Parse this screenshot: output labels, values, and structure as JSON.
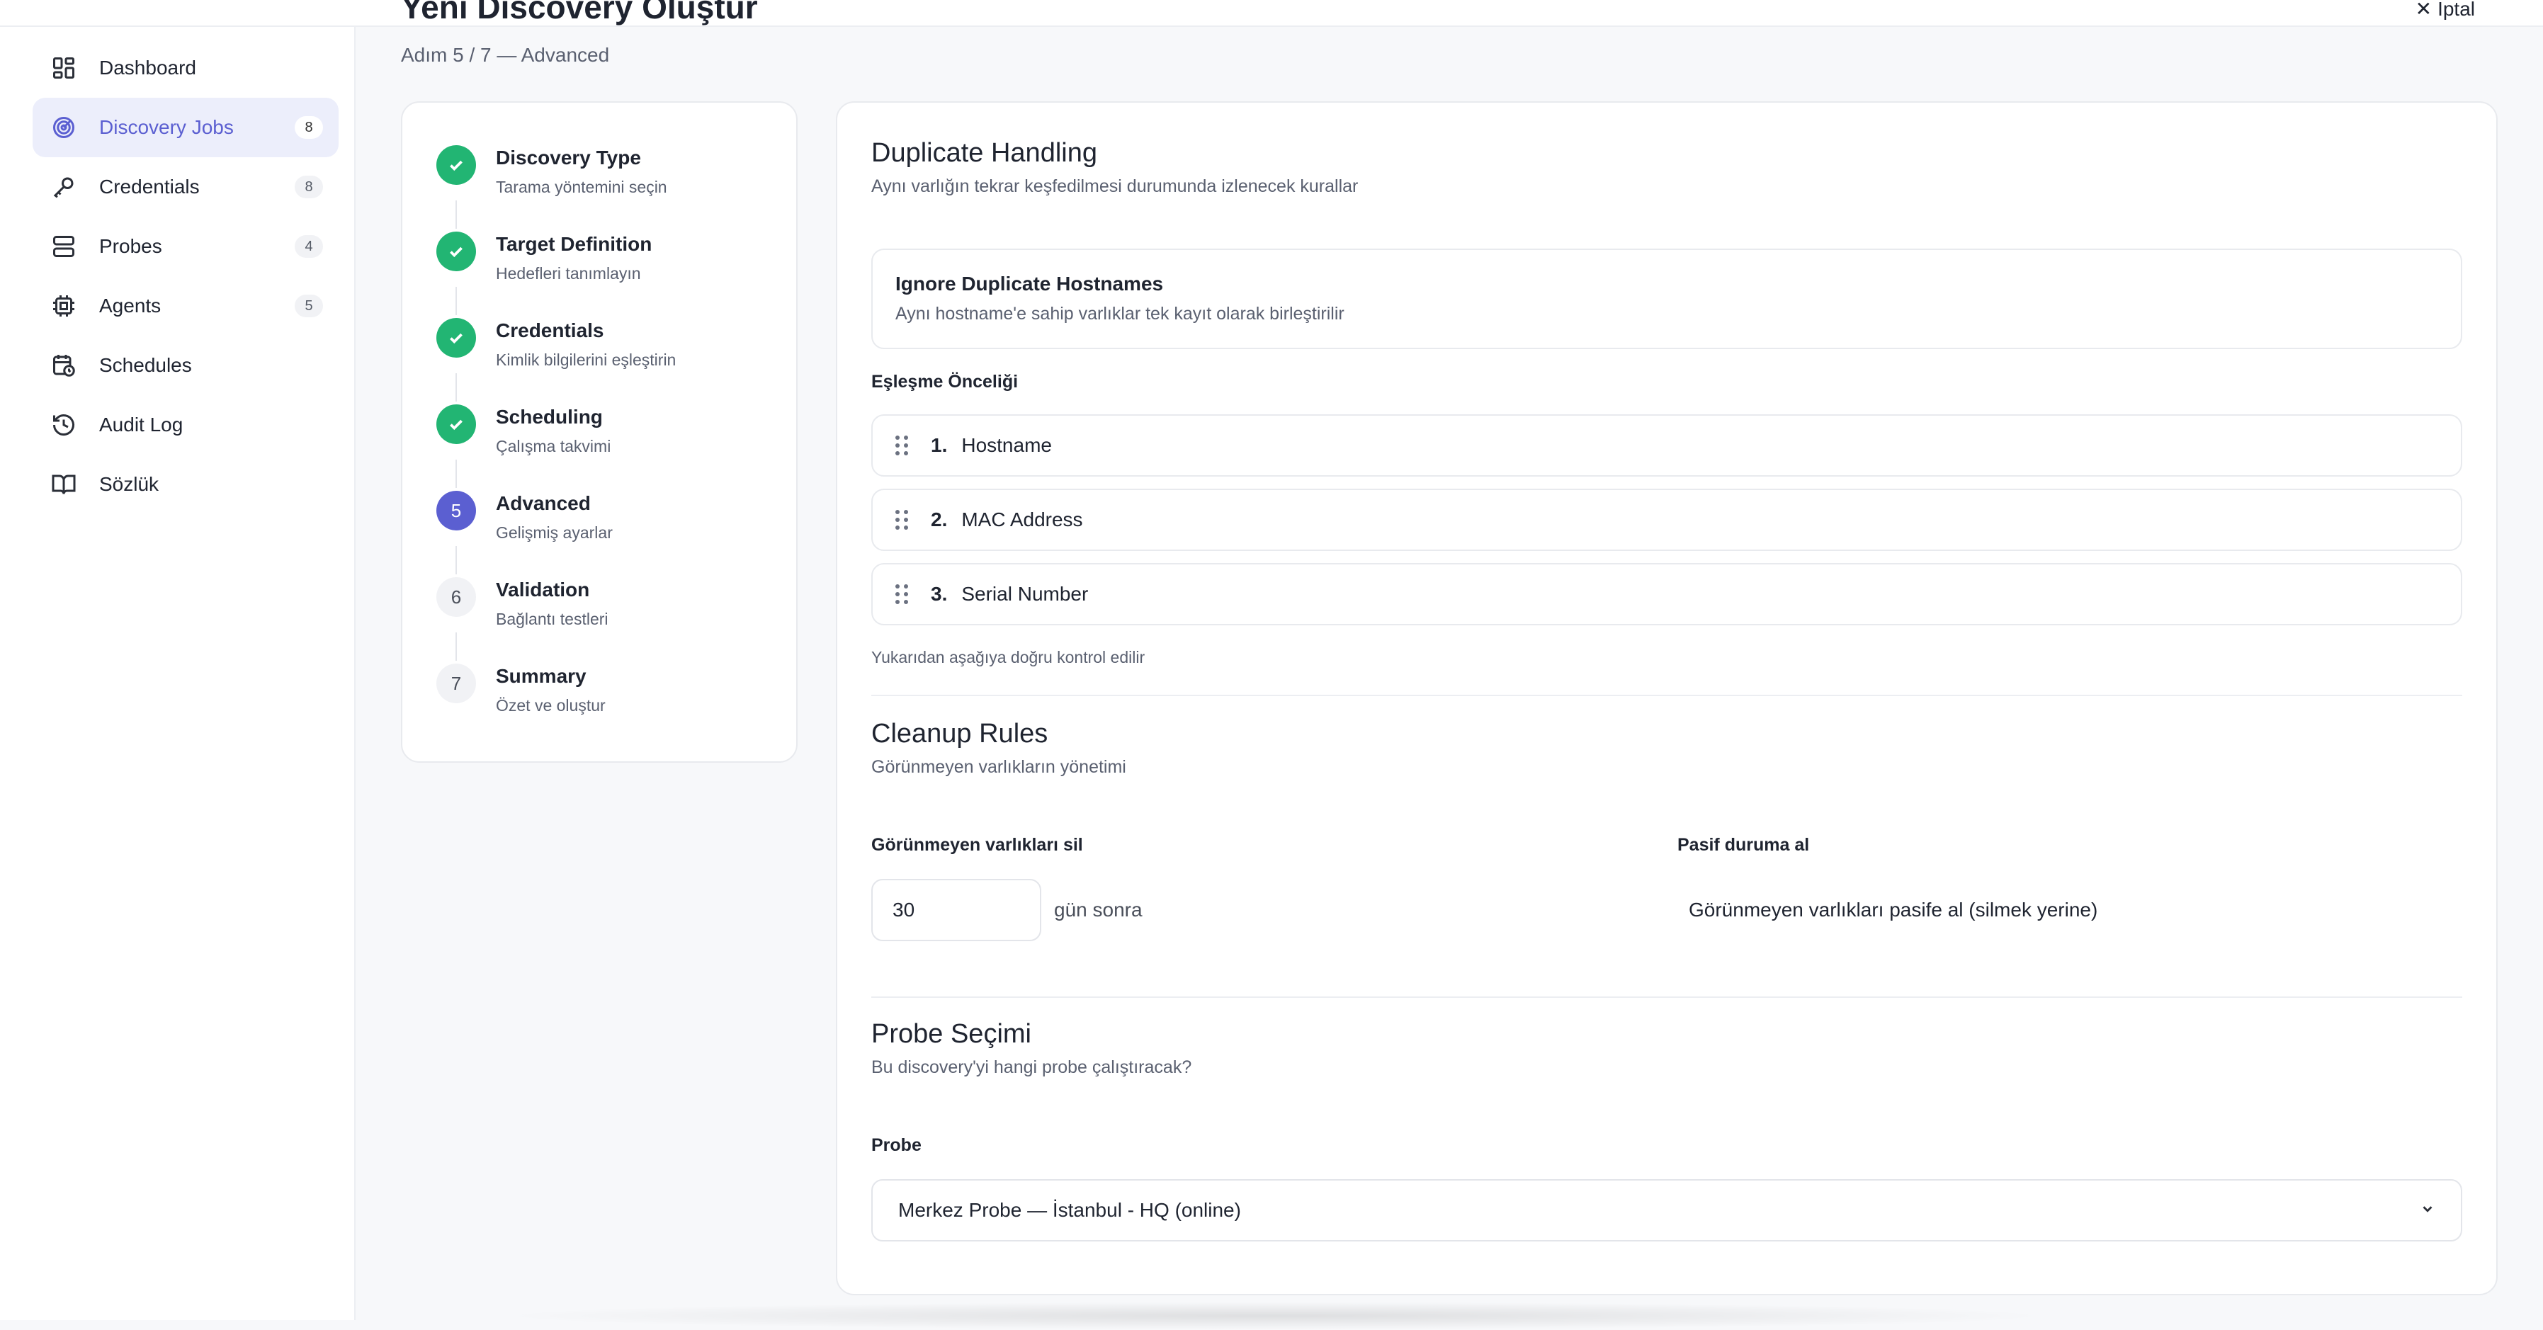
{
  "header": {
    "title": "Yeni Discovery Oluştur",
    "cancel_label": "İptal",
    "step_indicator": "Adım 5 / 7 — Advanced"
  },
  "sidebar": {
    "items": [
      {
        "label": "Dashboard",
        "icon": "dashboard-icon",
        "count": null,
        "active": false
      },
      {
        "label": "Discovery Jobs",
        "icon": "radar-icon",
        "count": "8",
        "active": true
      },
      {
        "label": "Credentials",
        "icon": "key-icon",
        "count": "8",
        "active": false
      },
      {
        "label": "Probes",
        "icon": "server-icon",
        "count": "4",
        "active": false
      },
      {
        "label": "Agents",
        "icon": "cpu-icon",
        "count": "5",
        "active": false
      },
      {
        "label": "Schedules",
        "icon": "calendar-clock-icon",
        "count": null,
        "active": false
      },
      {
        "label": "Audit Log",
        "icon": "history-icon",
        "count": null,
        "active": false
      },
      {
        "label": "Sözlük",
        "icon": "book-icon",
        "count": null,
        "active": false
      }
    ]
  },
  "steps": [
    {
      "number": "1",
      "title": "Discovery Type",
      "subtitle": "Tarama yöntemini seçin",
      "status": "done"
    },
    {
      "number": "2",
      "title": "Target Definition",
      "subtitle": "Hedefleri tanımlayın",
      "status": "done"
    },
    {
      "number": "3",
      "title": "Credentials",
      "subtitle": "Kimlik bilgilerini eşleştirin",
      "status": "done"
    },
    {
      "number": "4",
      "title": "Scheduling",
      "subtitle": "Çalışma takvimi",
      "status": "done"
    },
    {
      "number": "5",
      "title": "Advanced",
      "subtitle": "Gelişmiş ayarlar",
      "status": "current"
    },
    {
      "number": "6",
      "title": "Validation",
      "subtitle": "Bağlantı testleri",
      "status": "pending"
    },
    {
      "number": "7",
      "title": "Summary",
      "subtitle": "Özet ve oluştur",
      "status": "pending"
    }
  ],
  "duplicate": {
    "title": "Duplicate Handling",
    "subtitle": "Aynı varlığın tekrar keşfedilmesi durumunda izlenecek kurallar",
    "ignore_title": "Ignore Duplicate Hostnames",
    "ignore_subtitle": "Aynı hostname'e sahip varlıklar tek kayıt olarak birleştirilir",
    "priority_label": "Eşleşme Önceliği",
    "priority": [
      {
        "num": "1.",
        "name": "Hostname"
      },
      {
        "num": "2.",
        "name": "MAC Address"
      },
      {
        "num": "3.",
        "name": "Serial Number"
      }
    ],
    "hint": "Yukarıdan aşağıya doğru kontrol edilir"
  },
  "cleanup": {
    "title": "Cleanup Rules",
    "subtitle": "Görünmeyen varlıkların yönetimi",
    "delete_label": "Görünmeyen varlıkları sil",
    "days_value": "30",
    "days_suffix": "gün sonra",
    "passive_label": "Pasif duruma al",
    "passive_option": "Görünmeyen varlıkları pasife al (silmek yerine)"
  },
  "probe": {
    "title": "Probe Seçimi",
    "subtitle": "Bu discovery'yi hangi probe çalıştıracak?",
    "field_label": "Probe",
    "selected": "Merkez Probe — İstanbul - HQ (online)"
  },
  "colors": {
    "accent": "#5b5fd1",
    "success": "#22b573",
    "active_bg": "#eceefb",
    "border": "#e8eaee"
  }
}
